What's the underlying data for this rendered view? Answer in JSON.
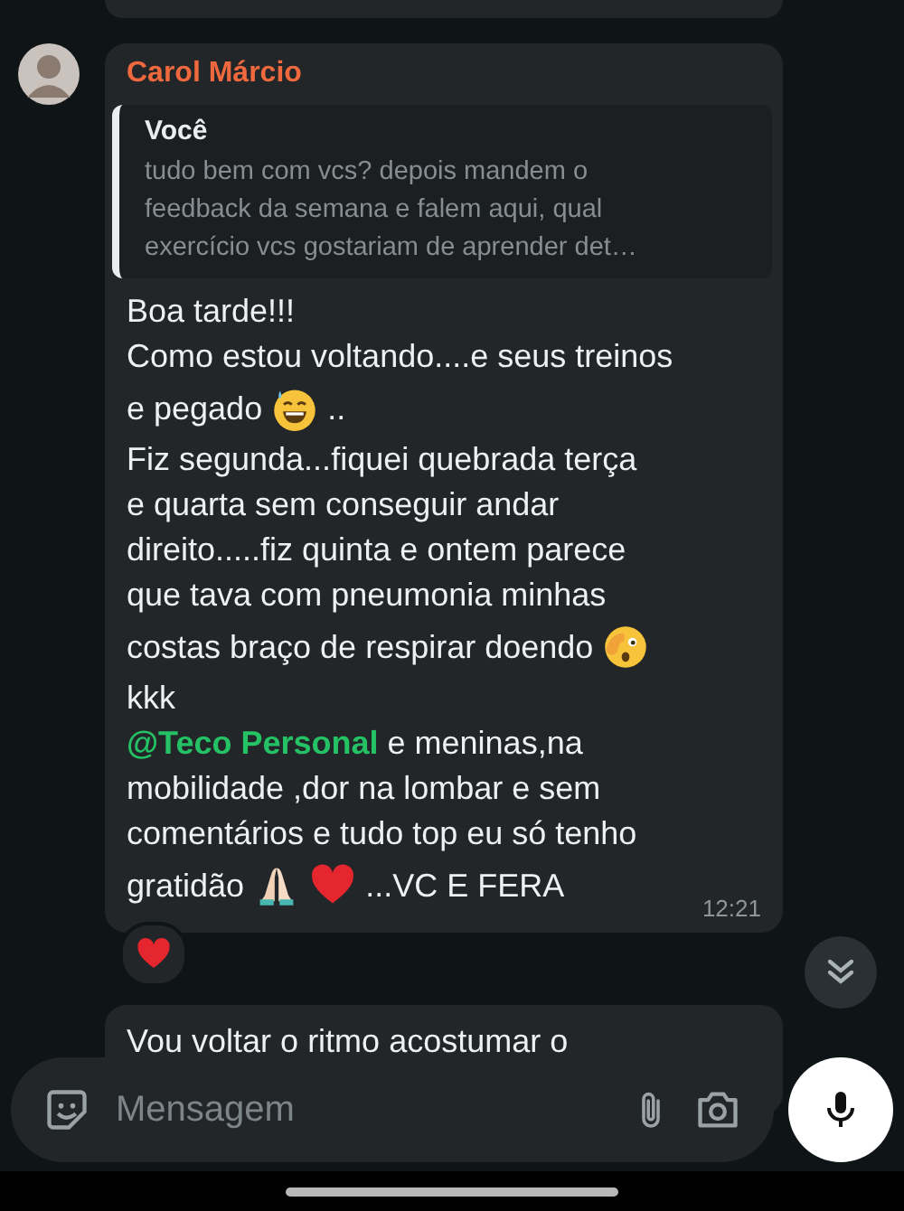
{
  "message": {
    "sender": "Carol Márcio",
    "quote": {
      "author": "Você",
      "lines": [
        "tudo bem com vcs? depois mandem o",
        "feedback da semana e falem aqui, qual",
        "exercício vcs gostariam de aprender det…"
      ]
    },
    "lines": [
      {
        "parts": [
          {
            "kind": "text",
            "text": "Boa tarde!!!"
          }
        ]
      },
      {
        "parts": [
          {
            "kind": "text",
            "text": "Como estou voltando....e seus treinos"
          }
        ]
      },
      {
        "parts": [
          {
            "kind": "text",
            "text": "e pegado"
          },
          {
            "kind": "sweat-grin"
          },
          {
            "kind": "text",
            "text": ".."
          }
        ]
      },
      {
        "parts": [
          {
            "kind": "text",
            "text": "Fiz segunda...fiquei quebrada terça"
          }
        ]
      },
      {
        "parts": [
          {
            "kind": "text",
            "text": "e quarta sem conseguir andar"
          }
        ]
      },
      {
        "parts": [
          {
            "kind": "text",
            "text": "direito.....fiz quinta e ontem parece"
          }
        ]
      },
      {
        "parts": [
          {
            "kind": "text",
            "text": "que tava com pneumonia minhas"
          }
        ]
      },
      {
        "parts": [
          {
            "kind": "text",
            "text": "costas braço de respirar doendo"
          },
          {
            "kind": "peek"
          }
        ]
      },
      {
        "parts": [
          {
            "kind": "text",
            "text": "kkk"
          }
        ]
      },
      {
        "parts": [
          {
            "kind": "mention",
            "text": "@Teco Personal"
          },
          {
            "kind": "text",
            "text": "e meninas,na"
          }
        ]
      },
      {
        "parts": [
          {
            "kind": "text",
            "text": "mobilidade ,dor na lombar e sem"
          }
        ]
      },
      {
        "parts": [
          {
            "kind": "text",
            "text": "comentários e tudo top eu só tenho"
          }
        ]
      },
      {
        "parts": [
          {
            "kind": "text",
            "text": "gratidão"
          },
          {
            "kind": "pray"
          },
          {
            "kind": "heart"
          },
          {
            "kind": "text",
            "text": "...VC E FERA"
          }
        ]
      }
    ],
    "time": "12:21",
    "heart_reaction": true
  },
  "next_message": {
    "text": "Vou voltar o ritmo acostumar o"
  },
  "composer": {
    "placeholder": "Mensagem"
  }
}
